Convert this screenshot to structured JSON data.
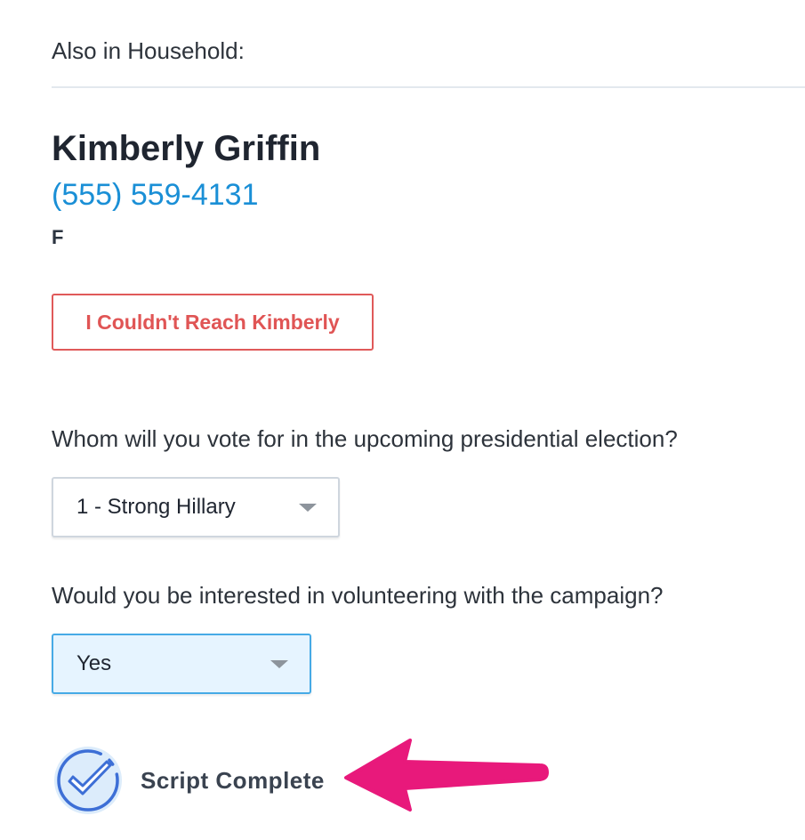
{
  "household": {
    "label": "Also in Household:"
  },
  "contact": {
    "name": "Kimberly Griffin",
    "phone": "(555) 559-4131",
    "gender": "F"
  },
  "actions": {
    "unreachable_label": "I Couldn't Reach Kimberly"
  },
  "questions": [
    {
      "text": "Whom will you vote for in the upcoming presidential election?",
      "selected": "1 - Strong Hillary"
    },
    {
      "text": "Would you be interested in volunteering with the campaign?",
      "selected": "Yes"
    }
  ],
  "script_complete": {
    "label": "Script Complete",
    "icon": "check-circle-icon"
  },
  "annotation": {
    "icon": "arrow-left-icon",
    "color": "#e8197b"
  },
  "colors": {
    "phone_link": "#1a8fd6",
    "danger": "#e05555",
    "selected_highlight": "#e6f4ff",
    "selected_border": "#46aae6"
  }
}
